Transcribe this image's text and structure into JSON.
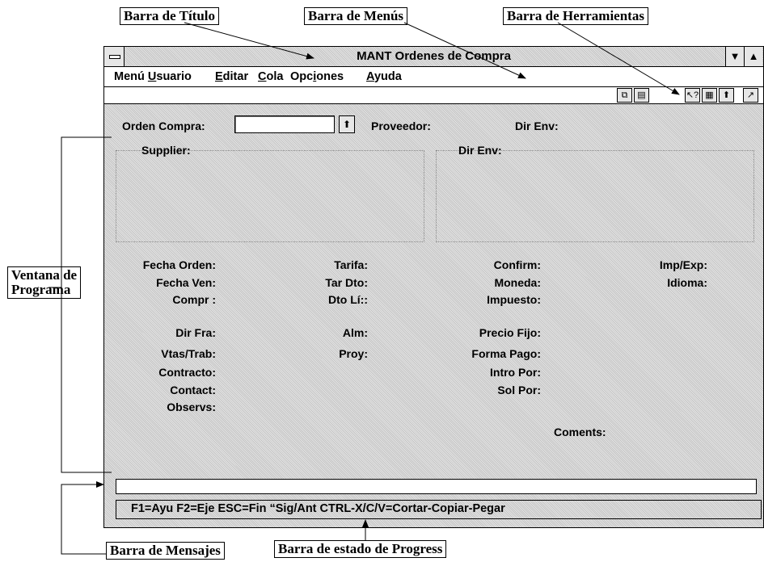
{
  "callouts": {
    "title_bar": "Barra de Título",
    "menu_bar": "Barra de Menús",
    "tool_bar": "Barra de Herramientas",
    "program_window_line1": "Ventana de",
    "program_window_line2": "Programa",
    "message_bar": "Barra de Mensajes",
    "status_bar": "Barra de estado de Progress"
  },
  "window": {
    "title": "MANT Ordenes de Compra",
    "menu": [
      {
        "pre": "Menú ",
        "acc": "U",
        "post": "suario"
      },
      {
        "pre": "",
        "acc": "E",
        "post": "ditar"
      },
      {
        "pre": "",
        "acc": "C",
        "post": "ola"
      },
      {
        "pre": "Opc",
        "acc": "i",
        "post": "ones"
      },
      {
        "pre": "",
        "acc": "A",
        "post": "yuda"
      }
    ],
    "toolbar_icons": [
      "copy-icon",
      "paste-icon",
      "help-query-icon",
      "notes-icon",
      "up-arrow-icon",
      "exit-icon"
    ]
  },
  "form": {
    "orden_compra": "Orden Compra:",
    "orden_compra_value": "",
    "proveedor": "Proveedor:",
    "dir_env_top": "Dir Env:",
    "supplier": "Supplier:",
    "dir_env": "Dir Env:",
    "col1": [
      "Fecha Orden:",
      "Fecha Ven:",
      "Compr :",
      "Dir Fra:",
      "Vtas/Trab:",
      "Contracto:",
      "Contact:",
      "Observs:"
    ],
    "col2": [
      "Tarifa:",
      "Tar Dto:",
      "Dto Lí::",
      "Alm:",
      "Proy:"
    ],
    "col3": [
      "Confirm:",
      "Moneda:",
      "Impuesto:",
      "Precio Fijo:",
      "Forma Pago:",
      "Intro Por:",
      "Sol Por:"
    ],
    "col4": [
      "Imp/Exp:",
      "Idioma:"
    ],
    "coments": "Coments:"
  },
  "message_bar_text": "",
  "status_text": "F1=Ayu  F2=Eje  ESC=Fin   “Sig/Ant  CTRL-X/C/V=Cortar-Copiar-Pegar"
}
